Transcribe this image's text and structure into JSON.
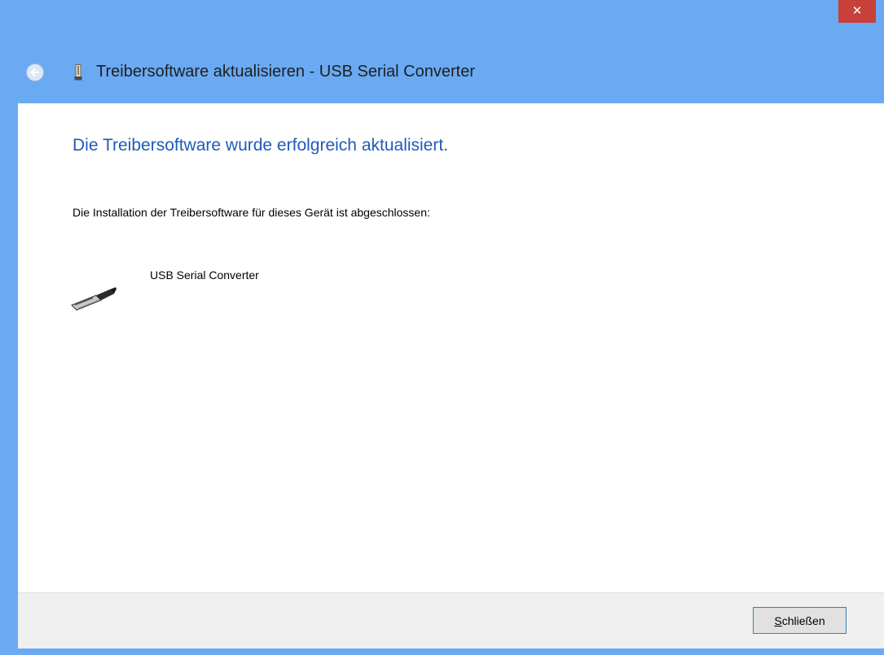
{
  "titlebar": {
    "close_glyph": "✕"
  },
  "nav": {
    "back_icon": "back-arrow-icon",
    "device_icon": "usb-device-icon",
    "title": "Treibersoftware aktualisieren - USB Serial Converter"
  },
  "main": {
    "heading": "Die Treibersoftware wurde erfolgreich aktualisiert.",
    "description": "Die Installation der Treibersoftware für dieses Gerät ist abgeschlossen:",
    "device_icon": "usb-plug-icon",
    "device_name": "USB Serial Converter"
  },
  "footer": {
    "close_label_accel": "S",
    "close_label_rest": "chließen"
  },
  "colors": {
    "frame": "#6aaaf3",
    "close_red": "#c7403a",
    "heading_blue": "#1f5bb8",
    "footer_bg": "#f0f0f0"
  }
}
